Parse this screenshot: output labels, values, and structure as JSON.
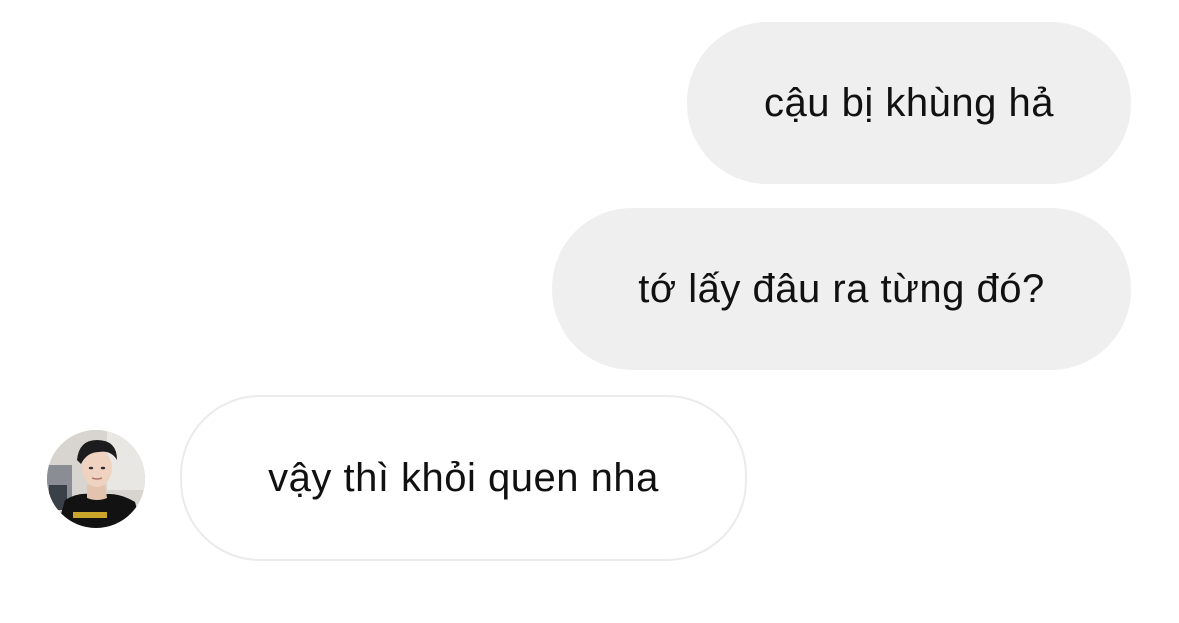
{
  "conversation": {
    "messages": [
      {
        "sender": "me",
        "text": "cậu bị khùng hả"
      },
      {
        "sender": "me",
        "text": "tớ lấy đâu ra từng đó?"
      },
      {
        "sender": "other",
        "text": "vậy thì khỏi quen nha"
      }
    ],
    "avatar": {
      "icon": "profile-photo",
      "shirt_text": "7SECONDS"
    }
  },
  "colors": {
    "sent_bubble": "#efefef",
    "received_border": "#ebebeb",
    "text": "#111111"
  }
}
